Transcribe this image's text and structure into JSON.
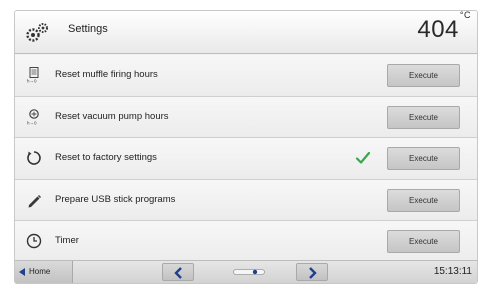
{
  "header": {
    "title": "Settings",
    "temperature": "404",
    "temperature_unit": "°C",
    "icon": "gears-icon"
  },
  "rows": [
    {
      "label": "Reset muffle firing hours",
      "icon": "counter-icon",
      "button": "Execute",
      "confirmed": false
    },
    {
      "label": "Reset vacuum pump hours",
      "icon": "vacuum-pump-icon",
      "button": "Execute",
      "confirmed": false
    },
    {
      "label": "Reset to factory settings",
      "icon": "reset-circle-icon",
      "button": "Execute",
      "confirmed": true
    },
    {
      "label": "Prepare USB stick programs",
      "icon": "pen-icon",
      "button": "Execute",
      "confirmed": false
    },
    {
      "label": "Timer",
      "icon": "clock-icon",
      "button": "Execute",
      "confirmed": false
    }
  ],
  "footer": {
    "home_label": "Home",
    "time": "15:13:11"
  },
  "colors": {
    "check": "#3aa84a",
    "nav_arrow": "#1f3f8f"
  }
}
